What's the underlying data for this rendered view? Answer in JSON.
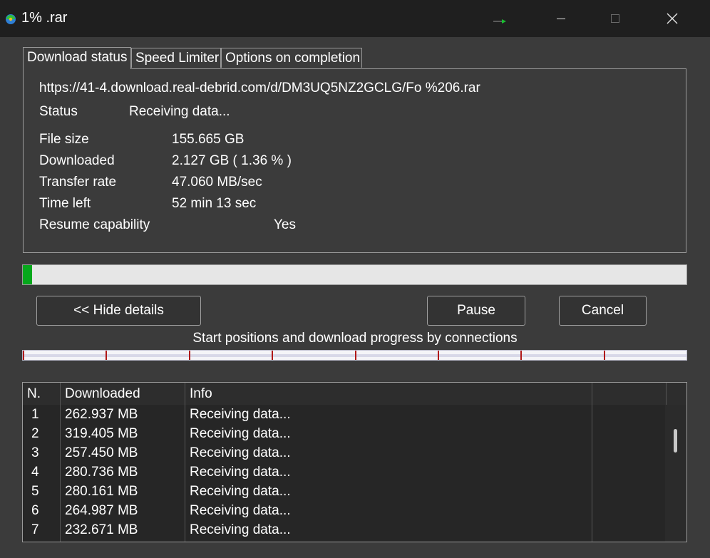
{
  "window": {
    "title": "1%                          .rar",
    "minimize_icon": "minimize-icon",
    "maximize_icon": "maximize-icon",
    "close_icon": "close-icon"
  },
  "tabs": [
    {
      "label": "Download status",
      "active": true
    },
    {
      "label": "Speed Limiter",
      "active": false
    },
    {
      "label": "Options on completion",
      "active": false
    }
  ],
  "status": {
    "url": "https://41-4.download.real-debrid.com/d/DM3UQ5NZ2GCLG/Fo                %206.rar",
    "status_label": "Status",
    "status_value": "Receiving data...",
    "file_size_label": "File size",
    "file_size_value": "155.665  GB",
    "downloaded_label": "Downloaded",
    "downloaded_value": "2.127  GB  ( 1.36 % )",
    "transfer_rate_label": "Transfer rate",
    "transfer_rate_value": "47.060  MB/sec",
    "time_left_label": "Time left",
    "time_left_value": "52 min 13 sec",
    "resume_label": "Resume capability",
    "resume_value": "Yes"
  },
  "progress": {
    "percent": 1.36,
    "fill_color": "#06a81c"
  },
  "buttons": {
    "hide_details": "<< Hide details",
    "pause": "Pause",
    "cancel": "Cancel"
  },
  "connections": {
    "caption": "Start positions and download progress by connections",
    "count": 8
  },
  "table": {
    "columns": [
      "N.",
      "Downloaded",
      "Info"
    ],
    "rows": [
      {
        "n": "1",
        "downloaded": "262.937  MB",
        "info": "Receiving data..."
      },
      {
        "n": "2",
        "downloaded": "319.405  MB",
        "info": "Receiving data..."
      },
      {
        "n": "3",
        "downloaded": "257.450  MB",
        "info": "Receiving data..."
      },
      {
        "n": "4",
        "downloaded": "280.736  MB",
        "info": "Receiving data..."
      },
      {
        "n": "5",
        "downloaded": "280.161  MB",
        "info": "Receiving data..."
      },
      {
        "n": "6",
        "downloaded": "264.987  MB",
        "info": "Receiving data..."
      },
      {
        "n": "7",
        "downloaded": "232.671  MB",
        "info": "Receiving data..."
      }
    ]
  }
}
